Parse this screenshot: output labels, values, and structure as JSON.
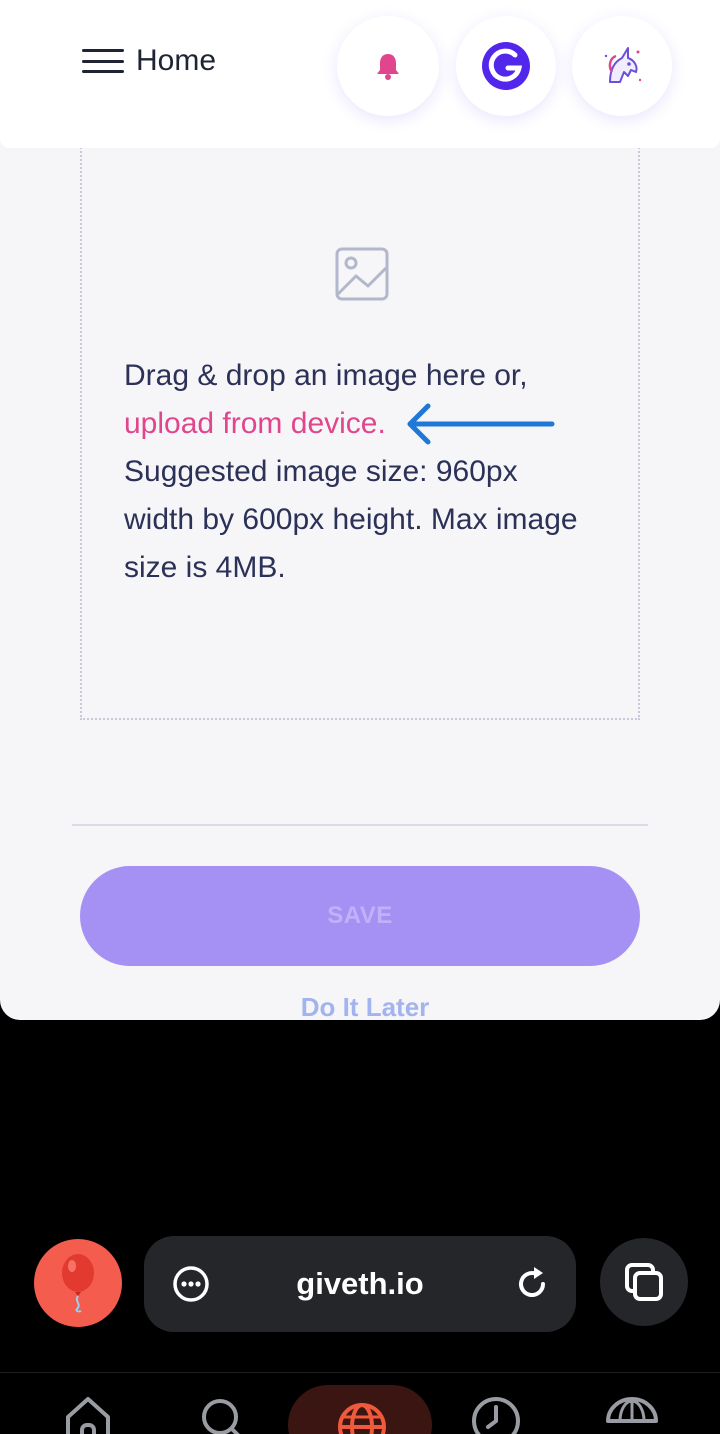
{
  "header": {
    "menu_label": "Home"
  },
  "dropzone": {
    "line_1": "Drag & drop an image here or,",
    "upload_link": "upload from device.",
    "size_hint": "Suggested image size: 960px width by 600px height. Max image size is 4MB."
  },
  "actions": {
    "save_label": "SAVE",
    "later_label": "Do It Later"
  },
  "browser": {
    "url": "giveth.io"
  },
  "colors": {
    "accent_pink": "#e1458d",
    "save_button": "#a491f3",
    "brand_purple": "#5326ec",
    "annotation_arrow": "#1f77d6"
  },
  "icons": {
    "menu": "hamburger-menu-icon",
    "notification": "bell-icon",
    "givbacks": "giv-logo-icon",
    "avatar": "unicorn-avatar-icon",
    "image_placeholder": "image-icon",
    "annotation": "arrow-left-icon",
    "browser_menu": "more-horizontal-icon",
    "reload": "reload-icon",
    "tabs": "tabs-icon",
    "balloon": "balloon-icon",
    "nav": [
      "home-icon",
      "search-icon",
      "globe-icon",
      "history-icon",
      "parachute-icon"
    ]
  }
}
